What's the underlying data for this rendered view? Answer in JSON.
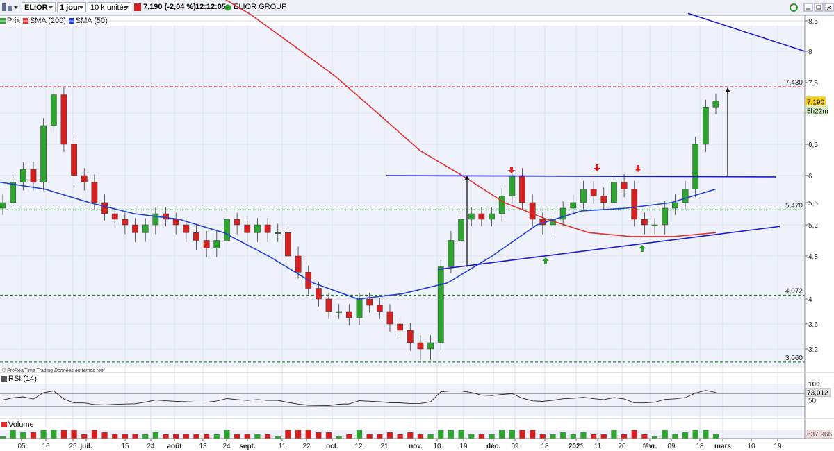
{
  "toolbar": {
    "symbol": "ELIOR",
    "period": "1 jour",
    "units": "10 k unités",
    "price_change": "7,190 (-2,04 %)",
    "time": "12:12:05",
    "company": "ELIOR GROUP"
  },
  "legend": {
    "price": "Prix",
    "sma200": "SMA (200)",
    "sma50": "SMA (50)"
  },
  "credit": {
    "source": "© ProRealTime Trading",
    "note": "Données en temps réel"
  },
  "price_axis": {
    "ticks": [
      "8,5",
      "8",
      "7,5",
      "7",
      "6,5",
      "6",
      "5,6",
      "5,2",
      "4,8",
      "4",
      "3,6",
      "3,2"
    ],
    "levels": [
      "7,430",
      "5,470",
      "4,072",
      "3,060"
    ],
    "last_price": "7,190",
    "countdown": "5h22m"
  },
  "rsi": {
    "label": "RSI (14)",
    "value": "73,012",
    "ticks": [
      "100",
      "50"
    ]
  },
  "volume": {
    "label": "Volume",
    "value": "637 966"
  },
  "x_axis": {
    "labels": [
      "05",
      "16",
      "25",
      "juil.",
      "15",
      "24",
      "août",
      "13",
      "24",
      "sept.",
      "11",
      "22",
      "oct.",
      "12",
      "21",
      "nov.",
      "10",
      "19",
      "déc.",
      "09",
      "18",
      "2021",
      "11",
      "20",
      "févr.",
      "09",
      "18",
      "mars",
      "10",
      "19"
    ]
  },
  "colors": {
    "up": "#2ea52e",
    "down": "#d62020",
    "sma200": "#e03030",
    "sma50": "#2040d0",
    "trendline": "#1a1acc",
    "level": "#d02020",
    "support": "#2a8a2a",
    "background": "#eff2fb",
    "last_price_bg": "#f5d020"
  },
  "chart_data": {
    "type": "candlestick",
    "title": "ELIOR GROUP",
    "ylim": [
      3.0,
      8.6
    ],
    "series": [
      {
        "name": "Prix",
        "close": [
          5.6,
          5.9,
          6.1,
          5.9,
          6.8,
          7.3,
          6.5,
          6.0,
          5.9,
          5.6,
          5.4,
          5.3,
          5.2,
          5.1,
          5.2,
          5.4,
          5.3,
          5.2,
          5.1,
          5.0,
          4.9,
          5.0,
          5.3,
          5.2,
          5.1,
          5.2,
          5.1,
          5.1,
          4.8,
          4.5,
          4.2,
          4.0,
          3.8,
          3.8,
          3.7,
          4.0,
          3.9,
          3.8,
          3.6,
          3.5,
          3.3,
          3.2,
          3.3,
          4.6,
          5.0,
          5.3,
          5.4,
          5.3,
          5.4,
          5.7,
          6.0,
          5.6,
          5.3,
          5.2,
          5.3,
          5.5,
          5.6,
          5.8,
          5.7,
          5.6,
          5.9,
          5.8,
          5.3,
          5.2,
          5.2,
          5.5,
          5.6,
          5.8,
          6.5,
          7.1,
          7.2
        ]
      },
      {
        "name": "SMA (200)",
        "values": [
          9.0,
          8.6,
          8.1,
          7.6,
          7.0,
          6.4,
          6.0,
          5.6,
          5.3,
          5.1,
          5.05,
          5.05,
          5.1
        ]
      },
      {
        "name": "SMA (50)",
        "values": [
          5.9,
          5.8,
          5.6,
          5.4,
          5.3,
          5.1,
          4.8,
          4.3,
          4.0,
          4.1,
          4.3,
          4.8,
          5.2,
          5.45,
          5.5,
          5.6,
          5.8
        ]
      }
    ],
    "levels": [
      7.43,
      5.47,
      4.072,
      3.06
    ],
    "rsi_last": 73.012,
    "volume_last": 637966
  }
}
